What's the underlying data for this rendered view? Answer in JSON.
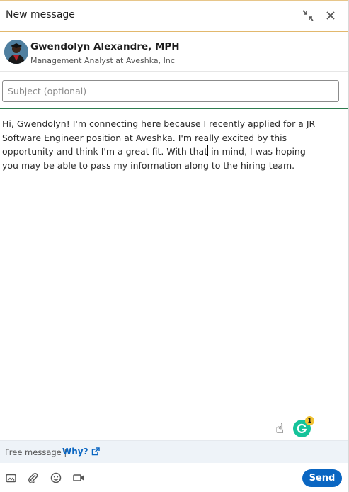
{
  "header": {
    "title": "New message",
    "minimize_icon": "minimize-arrows-icon",
    "close_icon": "close-icon"
  },
  "recipient": {
    "name": "Gwendolyn Alexandre, MPH",
    "headline": "Management Analyst at Aveshka, Inc"
  },
  "subject": {
    "placeholder": "Subject (optional)",
    "value": ""
  },
  "message": {
    "lines": [
      "Hi, Gwendolyn! I'm connecting here because I recently applied for a JR",
      "Software Engineer position at Aveshka. I'm really excited by this",
      "opportunity and think I'm a great fit. With that",
      " in mind, I was hoping",
      "you may be able to pass my information along to the hiring team."
    ]
  },
  "assist": {
    "hand_icon": "pointing-hand-icon",
    "grammarly_icon": "grammarly-icon",
    "grammarly_count": "1"
  },
  "footer": {
    "free_message": "Free message |",
    "why_label": "Why?",
    "external_icon": "external-link-icon"
  },
  "toolbar": {
    "image_icon": "image-icon",
    "attach_icon": "paperclip-icon",
    "emoji_icon": "emoji-icon",
    "video_icon": "video-icon",
    "send_label": "Send"
  },
  "colors": {
    "accent_blue": "#0a66c2",
    "divider_green": "#2e7d4f",
    "header_border": "#e2b86d",
    "grammarly_green": "#15c39a"
  }
}
